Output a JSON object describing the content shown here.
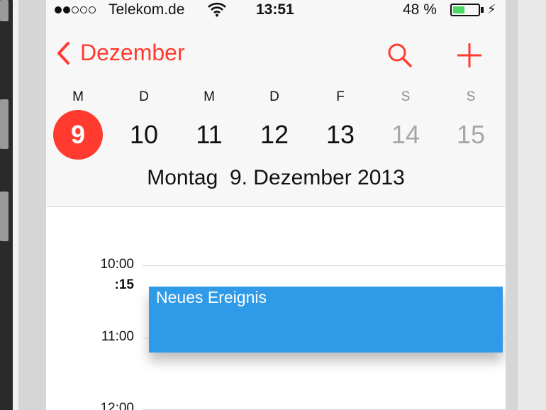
{
  "status_bar": {
    "carrier": "Telekom.de",
    "signal_strength": 2,
    "signal_total": 5,
    "time": "13:51",
    "battery_percent_text": "48 %",
    "battery_level": 0.48,
    "charging_icon": "lightning-bolt-icon",
    "wifi_icon": "wifi-icon"
  },
  "nav": {
    "back_label": "Dezember",
    "back_icon": "chevron-left-icon",
    "search_icon": "search-icon",
    "add_icon": "plus-icon",
    "accent_color": "#ff3b30"
  },
  "week": {
    "weekdays": [
      "M",
      "D",
      "M",
      "D",
      "F",
      "S",
      "S"
    ],
    "days": [
      "9",
      "10",
      "11",
      "12",
      "13",
      "14",
      "15"
    ],
    "selected_index": 0,
    "weekend_indices": [
      5,
      6
    ],
    "full_date": "Montag  9. Dezember 2013"
  },
  "timeline": {
    "labels": [
      "10:00",
      ":15",
      "11:00",
      "12:00"
    ],
    "event": {
      "title": "Neues Ereignis",
      "color": "#2f9be8"
    }
  }
}
